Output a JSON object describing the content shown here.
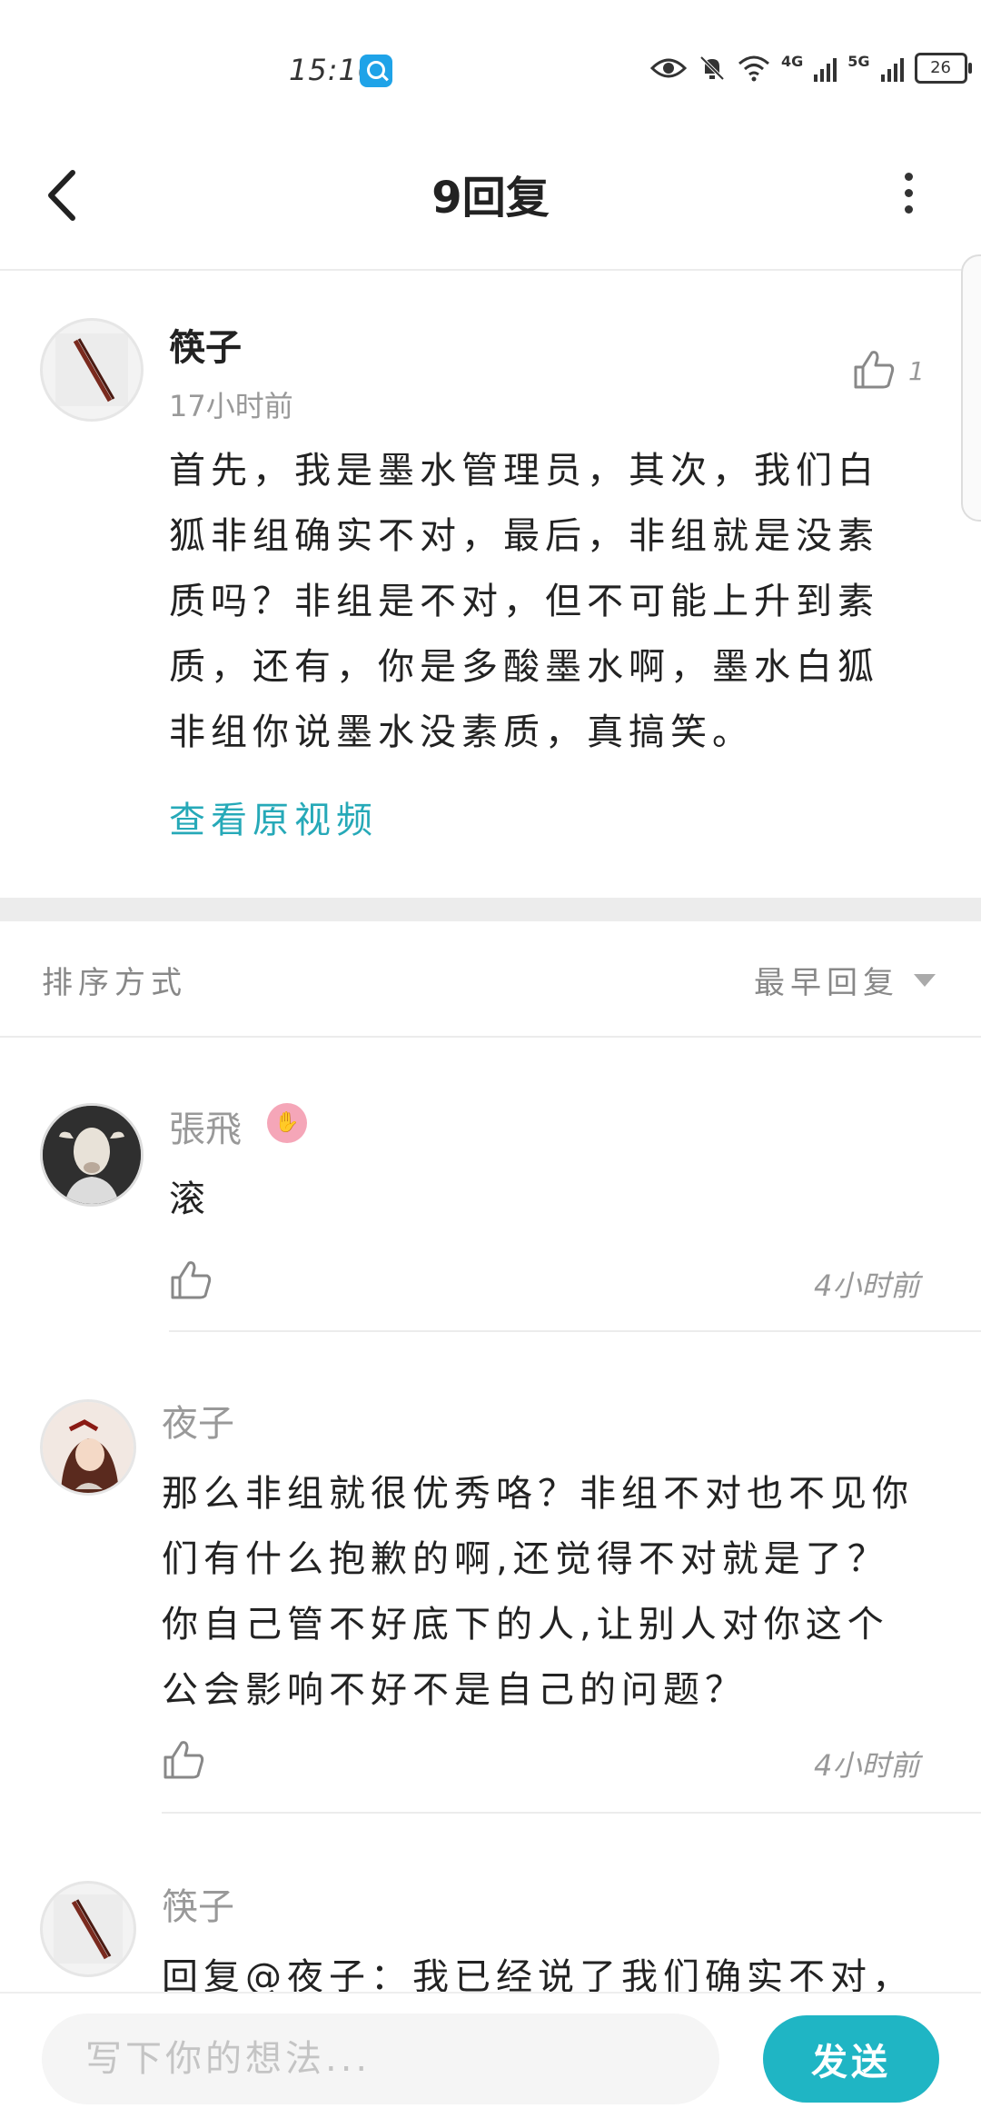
{
  "status_bar": {
    "time": "15:10",
    "net_4g": "4G",
    "net_5g": "5G",
    "battery": "26"
  },
  "header": {
    "title": "9回复"
  },
  "top_comment": {
    "author": "筷子",
    "time": "17小时前",
    "like_count": "1",
    "body": "首先，我是墨水管理员，其次，我们白狐非组确实不对，最后，非组就是没素质吗？非组是不对，但不可能上升到素质，还有，你是多酸墨水啊，墨水白狐非组你说墨水没素质，真搞笑。",
    "view_video": "查看原视频"
  },
  "sort": {
    "label": "排序方式",
    "value": "最早回复"
  },
  "replies": [
    {
      "author": "張飛",
      "body": "滚",
      "time": "4小时前"
    },
    {
      "author": "夜子",
      "body": "那么非组就很优秀咯？非组不对也不见你们有什么抱歉的啊,还觉得不对就是了？你自己管不好底下的人,让别人对你这个公会影响不好不是自己的问题？",
      "time": "4小时前"
    },
    {
      "author": "筷子",
      "body": "回复@夜子：我已经说了我们确实不对，"
    }
  ],
  "composer": {
    "placeholder": "写下你的想法...",
    "send_label": "发送"
  },
  "colors": {
    "accent": "#1fb5c4",
    "link": "#26a9b8",
    "badge": "#f5a6b8"
  }
}
